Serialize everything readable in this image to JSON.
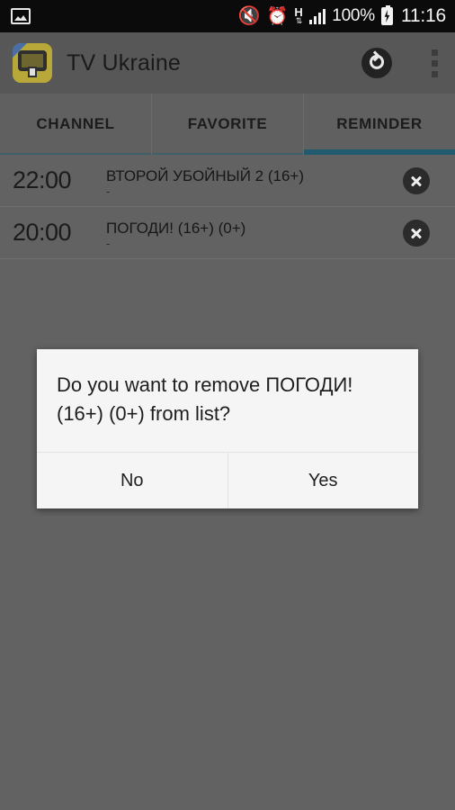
{
  "status_bar": {
    "left_icons": [
      "gallery-icon"
    ],
    "right_icons": [
      "mute-icon",
      "alarm-icon",
      "h-data-icon",
      "signal-icon",
      "battery-charging-icon"
    ],
    "battery_percent": "100%",
    "clock": "11:16"
  },
  "app_bar": {
    "logo": "tv-ukraine-logo",
    "title": "TV Ukraine",
    "refresh_icon": "refresh-icon",
    "overflow_icon": "overflow-menu-icon"
  },
  "tabs": {
    "items": [
      {
        "label": "CHANNEL",
        "selected": false
      },
      {
        "label": "FAVORITE",
        "selected": false
      },
      {
        "label": "REMINDER",
        "selected": true
      }
    ],
    "indicator_color": "#225a6e"
  },
  "reminders": [
    {
      "time": "22:00",
      "title": "ВТОРОЙ УБОЙНЫЙ 2 (16+)",
      "sub": "-",
      "remove_icon": "close-circle-icon"
    },
    {
      "time": "20:00",
      "title": "ПОГОДИ! (16+) (0+)",
      "sub": "-",
      "remove_icon": "close-circle-icon"
    }
  ],
  "dialog": {
    "message": "Do you want to remove ПОГОДИ! (16+) (0+) from list?",
    "no_label": "No",
    "yes_label": "Yes"
  },
  "colors": {
    "scrim": "#626262",
    "app_bar": "#575757",
    "status_bar": "#0b0b0b",
    "dialog_bg": "#f5f5f5",
    "accent": "#225a6e"
  }
}
